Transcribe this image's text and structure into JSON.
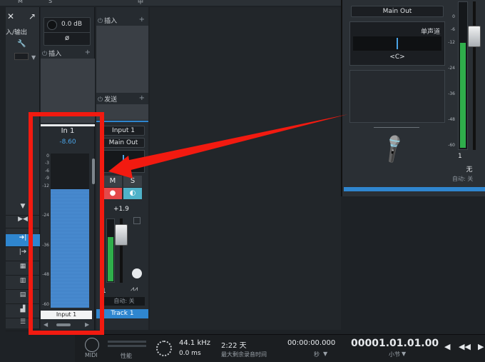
{
  "top_strip": {
    "labels": [
      "M",
      "S",
      "中"
    ]
  },
  "left_panel": {
    "io_label": "入/输出",
    "wrench": "🔧"
  },
  "input_channel": {
    "gain_value": "0.0 dB",
    "phase_symbol": "ø",
    "inserts_label": "插入",
    "name": "In 1",
    "level": "-8.60",
    "meter_scale": [
      "0",
      "-3",
      "-6",
      "-9",
      "-12",
      "-24",
      "-36",
      "-48",
      "-60"
    ],
    "meter_fill_fraction": 0.77,
    "footer_label": "Input 1"
  },
  "track_channel": {
    "inserts_label": "插入",
    "sends_label": "发送",
    "input": "Input 1",
    "output": "Main Out",
    "mute_label": "M",
    "solo_label": "S",
    "volume_value": "+1.9",
    "channel_number": "1",
    "automation": "自动: 关",
    "name": "Track 1"
  },
  "main_out_panel": {
    "output": "Main Out",
    "pan_mode": "单声道",
    "pan_value": "<C>",
    "scale": [
      "0",
      "-6",
      "-12",
      "-24",
      "-36",
      "-48",
      "-60"
    ],
    "channel_number": "1",
    "none_label": "无",
    "automation": "自动: 关",
    "meter_fill_fraction": 0.72
  },
  "transport": {
    "midi_label": "MIDI",
    "perf_label": "性能",
    "sample_rate": "44.1 kHz",
    "latency": "0.0 ms",
    "record_time": "2:22 天",
    "record_time_label": "最大剩余录音时间",
    "timecode": "00:00:00.000",
    "timecode_unit": "秒",
    "bars": "00001.01.01.00",
    "bars_unit": "小节"
  },
  "colors": {
    "accent": "#2f86cf",
    "annotation": "#f21a10",
    "meter_blue": "#3f7fc4",
    "meter_green": "#2fae4b"
  }
}
